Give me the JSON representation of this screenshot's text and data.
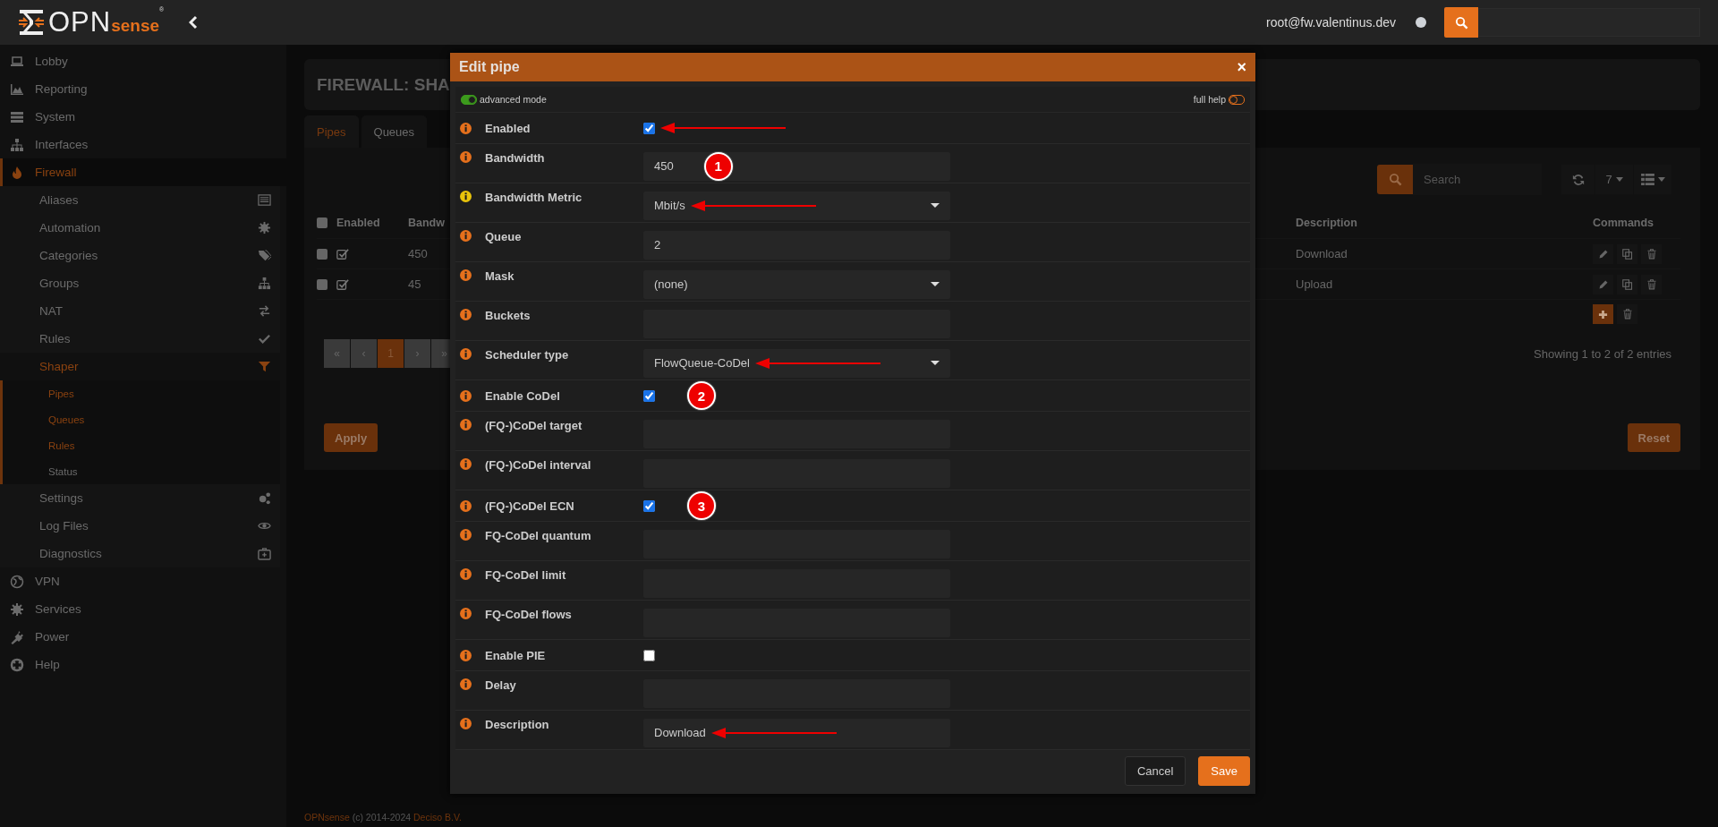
{
  "header": {
    "logo": [
      "OPN",
      "sense",
      "®"
    ],
    "user": "root@fw.valentinus.dev"
  },
  "sidebar": {
    "items": [
      {
        "label": "Lobby",
        "selected": false
      },
      {
        "label": "Reporting",
        "selected": false
      },
      {
        "label": "System",
        "selected": false
      },
      {
        "label": "Interfaces",
        "selected": false
      },
      {
        "label": "Firewall",
        "selected": true,
        "expanded": true,
        "children": [
          {
            "label": "Aliases",
            "selected": false
          },
          {
            "label": "Automation",
            "selected": false
          },
          {
            "label": "Categories",
            "selected": false
          },
          {
            "label": "Groups",
            "selected": false
          },
          {
            "label": "NAT",
            "selected": false
          },
          {
            "label": "Rules",
            "selected": false
          },
          {
            "label": "Shaper",
            "selected": true,
            "expanded": true,
            "children": [
              {
                "label": "Pipes",
                "selected": true
              },
              {
                "label": "Queues",
                "selected": true
              },
              {
                "label": "Rules",
                "selected": true
              },
              {
                "label": "Status",
                "selected": false
              }
            ]
          },
          {
            "label": "Settings",
            "selected": false
          },
          {
            "label": "Log Files",
            "selected": false
          },
          {
            "label": "Diagnostics",
            "selected": false
          }
        ]
      },
      {
        "label": "VPN",
        "selected": false
      },
      {
        "label": "Services",
        "selected": false
      },
      {
        "label": "Power",
        "selected": false
      },
      {
        "label": "Help",
        "selected": false
      }
    ]
  },
  "page": {
    "title": "FIREWALL: SHA",
    "tabs": [
      {
        "label": "Pipes",
        "selected": true
      },
      {
        "label": "Queues",
        "selected": false
      }
    ],
    "toolbar": {
      "search_placeholder": "Search",
      "page_size": "7"
    },
    "table": {
      "select_all": false,
      "columns": [
        "Enabled",
        "Bandw",
        "Description",
        "Commands"
      ],
      "rows": [
        {
          "selected": false,
          "enabled": true,
          "bandwidth": "450",
          "description": "Download"
        },
        {
          "selected": false,
          "enabled": true,
          "bandwidth": "45",
          "description": "Upload"
        }
      ]
    },
    "pagination": [
      {
        "label": "«",
        "selected": false
      },
      {
        "label": "‹",
        "selected": false
      },
      {
        "label": "1",
        "selected": true
      },
      {
        "label": "›",
        "selected": false
      },
      {
        "label": "»",
        "selected": false
      }
    ],
    "info": "Showing 1 to 2 of 2 entries",
    "apply": "Apply",
    "reset": "Reset"
  },
  "footer": [
    "OPNsense",
    "(c) 2014-2024",
    "Deciso B.V."
  ],
  "modal": {
    "title": "Edit pipe",
    "close": "×",
    "advanced_mode": {
      "label": "advanced mode",
      "on": true
    },
    "full_help": {
      "label": "full help",
      "on": false
    },
    "fields": [
      {
        "kind": "checkbox",
        "label": "Enabled",
        "checked": true,
        "color": "#e5701c",
        "arrow": true
      },
      {
        "kind": "text",
        "label": "Bandwidth",
        "value": "450",
        "color": "#e5701c",
        "callout": "1"
      },
      {
        "kind": "select",
        "label": "Bandwidth Metric",
        "value": "Mbit/s",
        "color": "#e8c30b",
        "arrow": true
      },
      {
        "kind": "text",
        "label": "Queue",
        "value": "2",
        "color": "#e5701c"
      },
      {
        "kind": "select",
        "label": "Mask",
        "value": "(none)",
        "color": "#e5701c"
      },
      {
        "kind": "text",
        "label": "Buckets",
        "color": "#e5701c"
      },
      {
        "kind": "select",
        "label": "Scheduler type",
        "value": "FlowQueue-CoDel",
        "color": "#e5701c",
        "arrow": true
      },
      {
        "kind": "checkbox",
        "label": "Enable CoDel",
        "checked": true,
        "color": "#e5701c",
        "callout": "2"
      },
      {
        "kind": "text",
        "label": "(FQ-)CoDel target",
        "color": "#e5701c"
      },
      {
        "kind": "text",
        "label": "(FQ-)CoDel interval",
        "color": "#e5701c"
      },
      {
        "kind": "checkbox",
        "label": "(FQ-)CoDel ECN",
        "checked": true,
        "color": "#e5701c",
        "callout": "3"
      },
      {
        "kind": "text",
        "label": "FQ-CoDel quantum",
        "color": "#e5701c"
      },
      {
        "kind": "text",
        "label": "FQ-CoDel limit",
        "color": "#e5701c"
      },
      {
        "kind": "text",
        "label": "FQ-CoDel flows",
        "color": "#e5701c"
      },
      {
        "kind": "checkbox",
        "label": "Enable PIE",
        "checked": false,
        "color": "#e5701c"
      },
      {
        "kind": "text",
        "label": "Delay",
        "color": "#e5701c"
      },
      {
        "kind": "text",
        "label": "Description",
        "value": "Download",
        "color": "#e5701c",
        "arrow": true
      }
    ],
    "buttons": [
      {
        "label": "Cancel",
        "kind": "default"
      },
      {
        "label": "Save",
        "kind": "primary"
      }
    ]
  }
}
